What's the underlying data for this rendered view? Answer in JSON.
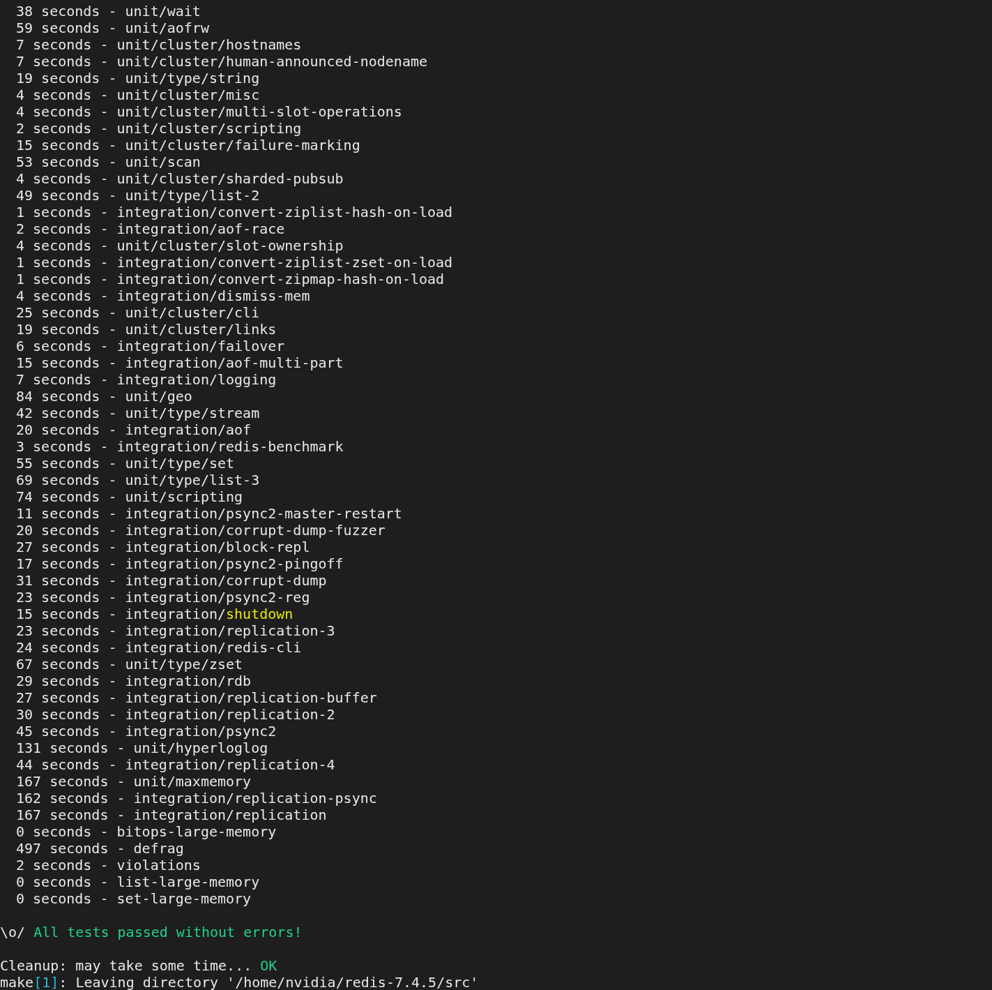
{
  "terminal": {
    "lines": [
      {
        "indent": true,
        "segments": [
          {
            "kind": "normal",
            "text": "38 seconds - unit/wait"
          }
        ]
      },
      {
        "indent": true,
        "segments": [
          {
            "kind": "normal",
            "text": "59 seconds - unit/aofrw"
          }
        ]
      },
      {
        "indent": true,
        "segments": [
          {
            "kind": "normal",
            "text": "7 seconds - unit/cluster/hostnames"
          }
        ]
      },
      {
        "indent": true,
        "segments": [
          {
            "kind": "normal",
            "text": "7 seconds - unit/cluster/human-announced-nodename"
          }
        ]
      },
      {
        "indent": true,
        "segments": [
          {
            "kind": "normal",
            "text": "19 seconds - unit/type/string"
          }
        ]
      },
      {
        "indent": true,
        "segments": [
          {
            "kind": "normal",
            "text": "4 seconds - unit/cluster/misc"
          }
        ]
      },
      {
        "indent": true,
        "segments": [
          {
            "kind": "normal",
            "text": "4 seconds - unit/cluster/multi-slot-operations"
          }
        ]
      },
      {
        "indent": true,
        "segments": [
          {
            "kind": "normal",
            "text": "2 seconds - unit/cluster/scripting"
          }
        ]
      },
      {
        "indent": true,
        "segments": [
          {
            "kind": "normal",
            "text": "15 seconds - unit/cluster/failure-marking"
          }
        ]
      },
      {
        "indent": true,
        "segments": [
          {
            "kind": "normal",
            "text": "53 seconds - unit/scan"
          }
        ]
      },
      {
        "indent": true,
        "segments": [
          {
            "kind": "normal",
            "text": "4 seconds - unit/cluster/sharded-pubsub"
          }
        ]
      },
      {
        "indent": true,
        "segments": [
          {
            "kind": "normal",
            "text": "49 seconds - unit/type/list-2"
          }
        ]
      },
      {
        "indent": true,
        "segments": [
          {
            "kind": "normal",
            "text": "1 seconds - integration/convert-ziplist-hash-on-load"
          }
        ]
      },
      {
        "indent": true,
        "segments": [
          {
            "kind": "normal",
            "text": "2 seconds - integration/aof-race"
          }
        ]
      },
      {
        "indent": true,
        "segments": [
          {
            "kind": "normal",
            "text": "4 seconds - unit/cluster/slot-ownership"
          }
        ]
      },
      {
        "indent": true,
        "segments": [
          {
            "kind": "normal",
            "text": "1 seconds - integration/convert-ziplist-zset-on-load"
          }
        ]
      },
      {
        "indent": true,
        "segments": [
          {
            "kind": "normal",
            "text": "1 seconds - integration/convert-zipmap-hash-on-load"
          }
        ]
      },
      {
        "indent": true,
        "segments": [
          {
            "kind": "normal",
            "text": "4 seconds - integration/dismiss-mem"
          }
        ]
      },
      {
        "indent": true,
        "segments": [
          {
            "kind": "normal",
            "text": "25 seconds - unit/cluster/cli"
          }
        ]
      },
      {
        "indent": true,
        "segments": [
          {
            "kind": "normal",
            "text": "19 seconds - unit/cluster/links"
          }
        ]
      },
      {
        "indent": true,
        "segments": [
          {
            "kind": "normal",
            "text": "6 seconds - integration/failover"
          }
        ]
      },
      {
        "indent": true,
        "segments": [
          {
            "kind": "normal",
            "text": "15 seconds - integration/aof-multi-part"
          }
        ]
      },
      {
        "indent": true,
        "segments": [
          {
            "kind": "normal",
            "text": "7 seconds - integration/logging"
          }
        ]
      },
      {
        "indent": true,
        "segments": [
          {
            "kind": "normal",
            "text": "84 seconds - unit/geo"
          }
        ]
      },
      {
        "indent": true,
        "segments": [
          {
            "kind": "normal",
            "text": "42 seconds - unit/type/stream"
          }
        ]
      },
      {
        "indent": true,
        "segments": [
          {
            "kind": "normal",
            "text": "20 seconds - integration/aof"
          }
        ]
      },
      {
        "indent": true,
        "segments": [
          {
            "kind": "normal",
            "text": "3 seconds - integration/redis-benchmark"
          }
        ]
      },
      {
        "indent": true,
        "segments": [
          {
            "kind": "normal",
            "text": "55 seconds - unit/type/set"
          }
        ]
      },
      {
        "indent": true,
        "segments": [
          {
            "kind": "normal",
            "text": "69 seconds - unit/type/list-3"
          }
        ]
      },
      {
        "indent": true,
        "segments": [
          {
            "kind": "normal",
            "text": "74 seconds - unit/scripting"
          }
        ]
      },
      {
        "indent": true,
        "segments": [
          {
            "kind": "normal",
            "text": "11 seconds - integration/psync2-master-restart"
          }
        ]
      },
      {
        "indent": true,
        "segments": [
          {
            "kind": "normal",
            "text": "20 seconds - integration/corrupt-dump-fuzzer"
          }
        ]
      },
      {
        "indent": true,
        "segments": [
          {
            "kind": "normal",
            "text": "27 seconds - integration/block-repl"
          }
        ]
      },
      {
        "indent": true,
        "segments": [
          {
            "kind": "normal",
            "text": "17 seconds - integration/psync2-pingoff"
          }
        ]
      },
      {
        "indent": true,
        "segments": [
          {
            "kind": "normal",
            "text": "31 seconds - integration/corrupt-dump"
          }
        ]
      },
      {
        "indent": true,
        "segments": [
          {
            "kind": "normal",
            "text": "23 seconds - integration/psync2-reg"
          }
        ]
      },
      {
        "indent": true,
        "segments": [
          {
            "kind": "normal",
            "text": "15 seconds - integration/"
          },
          {
            "kind": "warning",
            "text": "shutdown"
          }
        ]
      },
      {
        "indent": true,
        "segments": [
          {
            "kind": "normal",
            "text": "23 seconds - integration/replication-3"
          }
        ]
      },
      {
        "indent": true,
        "segments": [
          {
            "kind": "normal",
            "text": "24 seconds - integration/redis-cli"
          }
        ]
      },
      {
        "indent": true,
        "segments": [
          {
            "kind": "normal",
            "text": "67 seconds - unit/type/zset"
          }
        ]
      },
      {
        "indent": true,
        "segments": [
          {
            "kind": "normal",
            "text": "29 seconds - integration/rdb"
          }
        ]
      },
      {
        "indent": true,
        "segments": [
          {
            "kind": "normal",
            "text": "27 seconds - integration/replication-buffer"
          }
        ]
      },
      {
        "indent": true,
        "segments": [
          {
            "kind": "normal",
            "text": "30 seconds - integration/replication-2"
          }
        ]
      },
      {
        "indent": true,
        "segments": [
          {
            "kind": "normal",
            "text": "45 seconds - integration/psync2"
          }
        ]
      },
      {
        "indent": true,
        "segments": [
          {
            "kind": "normal",
            "text": "131 seconds - unit/hyperloglog"
          }
        ]
      },
      {
        "indent": true,
        "segments": [
          {
            "kind": "normal",
            "text": "44 seconds - integration/replication-4"
          }
        ]
      },
      {
        "indent": true,
        "segments": [
          {
            "kind": "normal",
            "text": "167 seconds - unit/maxmemory"
          }
        ]
      },
      {
        "indent": true,
        "segments": [
          {
            "kind": "normal",
            "text": "162 seconds - integration/replication-psync"
          }
        ]
      },
      {
        "indent": true,
        "segments": [
          {
            "kind": "normal",
            "text": "167 seconds - integration/replication"
          }
        ]
      },
      {
        "indent": true,
        "segments": [
          {
            "kind": "normal",
            "text": "0 seconds - bitops-large-memory"
          }
        ]
      },
      {
        "indent": true,
        "segments": [
          {
            "kind": "normal",
            "text": "497 seconds - defrag"
          }
        ]
      },
      {
        "indent": true,
        "segments": [
          {
            "kind": "normal",
            "text": "2 seconds - violations"
          }
        ]
      },
      {
        "indent": true,
        "segments": [
          {
            "kind": "normal",
            "text": "0 seconds - list-large-memory"
          }
        ]
      },
      {
        "indent": true,
        "segments": [
          {
            "kind": "normal",
            "text": "0 seconds - set-large-memory"
          }
        ]
      }
    ],
    "verdict": [
      {
        "indent": false,
        "segments": [
          {
            "kind": "normal",
            "text": "\\o/"
          },
          {
            "kind": "success",
            "text": " All tests passed without errors!"
          }
        ]
      }
    ],
    "cleanup": [
      {
        "indent": false,
        "segments": [
          {
            "kind": "normal",
            "text": "Cleanup: may take some time..."
          },
          {
            "kind": "success",
            "text": " OK"
          }
        ]
      },
      {
        "indent": false,
        "segments": [
          {
            "kind": "normal",
            "text": "make"
          },
          {
            "kind": "info",
            "text": "[1]"
          },
          {
            "kind": "normal",
            "text": ": Leaving directory '/home/nvidia/redis-7.4.5/src'"
          }
        ]
      }
    ]
  }
}
